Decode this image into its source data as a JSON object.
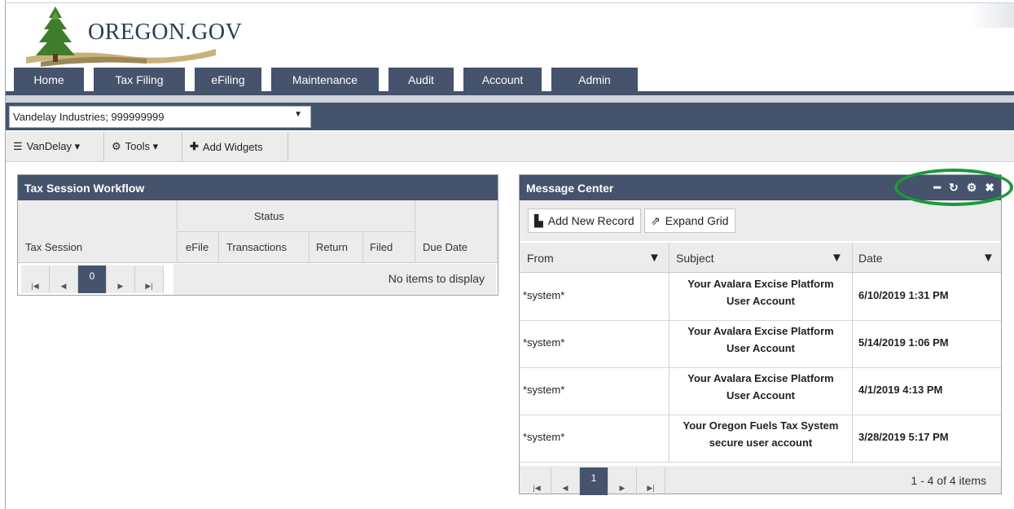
{
  "logo": {
    "text": "OREGON.GOV"
  },
  "nav": {
    "tabs": [
      "Home",
      "Tax Filing",
      "eFiling",
      "Maintenance",
      "Audit",
      "Account",
      "Admin"
    ]
  },
  "context": {
    "selected": "Vandelay Industries; 999999999"
  },
  "toolbar": {
    "vandelay": "VanDelay ▾",
    "tools": "Tools ▾",
    "add_widgets": "Add Widgets"
  },
  "tax_session": {
    "title": "Tax Session Workflow",
    "group_header": "Status",
    "columns": [
      "Tax Session",
      "eFile",
      "Transactions",
      "Return",
      "Filed",
      "Due Date"
    ],
    "current_page": "0",
    "empty_text": "No items to display"
  },
  "message_center": {
    "title": "Message Center",
    "add_record": "Add New Record",
    "expand_grid": "Expand Grid",
    "columns": [
      "From",
      "Subject",
      "Date"
    ],
    "rows": [
      {
        "from": "*system*",
        "subject": "Your Avalara Excise Platform User Account",
        "date": "6/10/2019 1:31 PM"
      },
      {
        "from": "*system*",
        "subject": "Your Avalara Excise Platform User Account",
        "date": "5/14/2019 1:06 PM"
      },
      {
        "from": "*system*",
        "subject": "Your Avalara Excise Platform User Account",
        "date": "4/1/2019 4:13 PM"
      },
      {
        "from": "*system*",
        "subject": "Your Oregon Fuels Tax System secure user account",
        "date": "3/28/2019 5:17 PM"
      }
    ],
    "current_page": "1",
    "items_text": "1 - 4 of 4 items"
  },
  "colors": {
    "nav": "#45536c",
    "highlight": "#1a9a3a"
  }
}
